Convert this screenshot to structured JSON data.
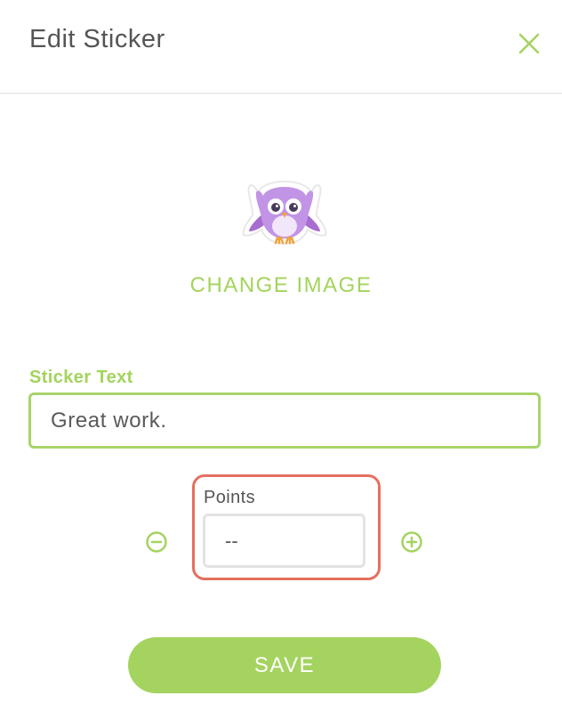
{
  "header": {
    "title": "Edit Sticker",
    "close_icon": "close-icon"
  },
  "sticker": {
    "icon": "owl-sticker-image",
    "change_image_label": "CHANGE IMAGE"
  },
  "sticker_text": {
    "label": "Sticker Text",
    "value": "Great work."
  },
  "points": {
    "label": "Points",
    "value": "--",
    "decrement_icon": "minus-circle-icon",
    "increment_icon": "plus-circle-icon"
  },
  "actions": {
    "save_label": "SAVE"
  },
  "colors": {
    "accent_green": "#a4d35f",
    "highlight_red": "#e56f5f",
    "title_gray": "#555555",
    "owl_purple": "#b07fd6"
  }
}
